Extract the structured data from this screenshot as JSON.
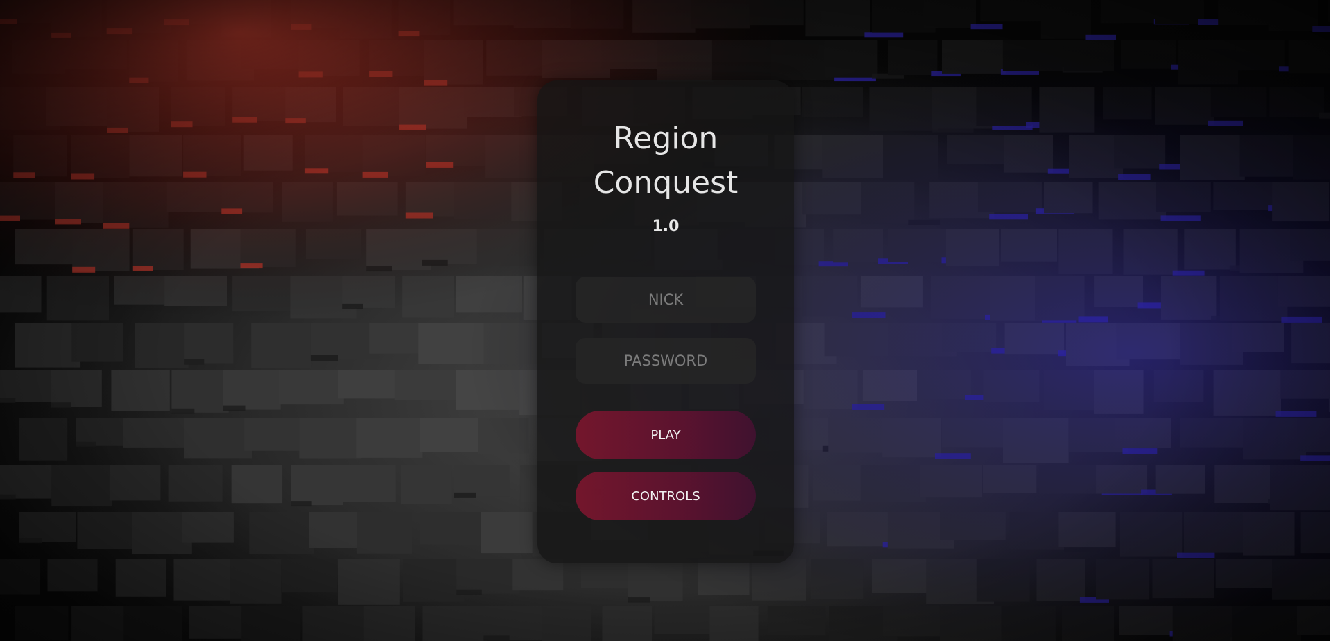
{
  "game": {
    "title_line1": "Region",
    "title_line2": "Conquest",
    "version": "1.0"
  },
  "form": {
    "nick_placeholder": "NICK",
    "password_placeholder": "PASSWORD",
    "play_label": "PLAY",
    "controls_label": "CONTROLS"
  },
  "colors": {
    "background": "#0a0a0a",
    "red_glow": "#c8372a",
    "blue_glow": "#3a2fc8",
    "panel": "#141414",
    "button": "#7a162d",
    "title_text": "#e6e6e6"
  }
}
